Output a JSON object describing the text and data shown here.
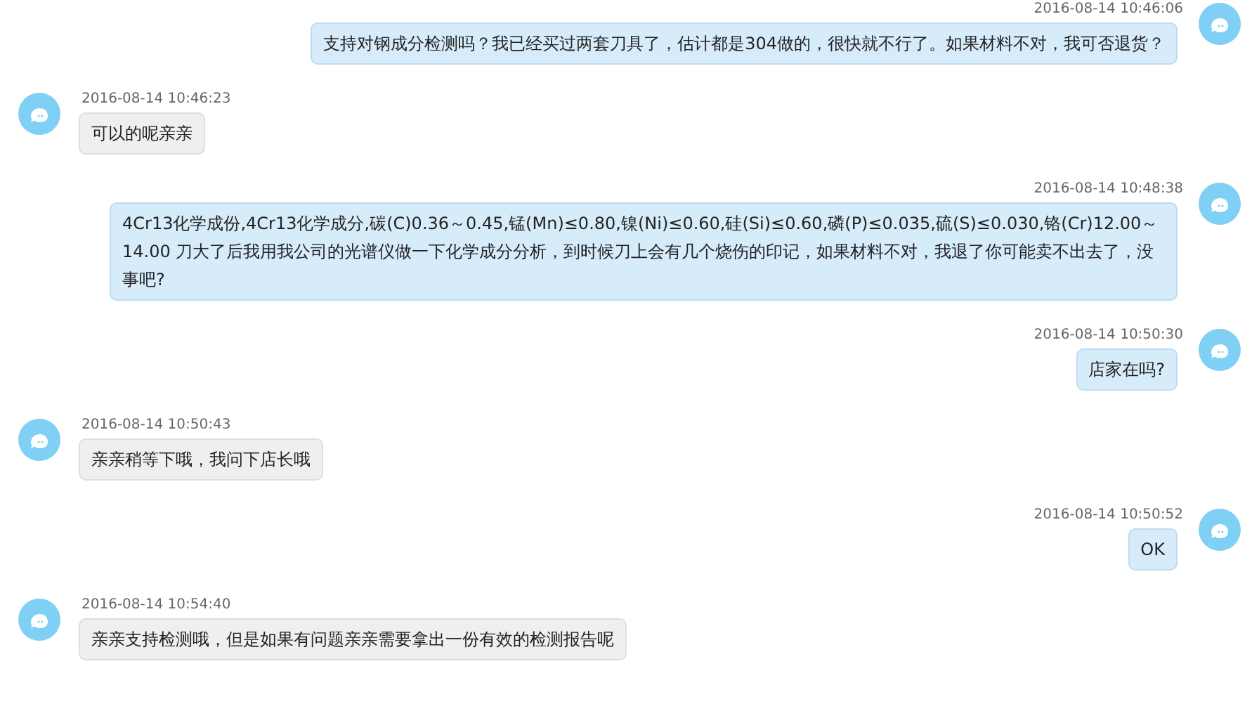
{
  "messages": [
    {
      "kind": "sent",
      "time": "2016-08-14 10:46:06",
      "text": "支持对钢成分检测吗？我已经买过两套刀具了，估计都是304做的，很快就不行了。如果材料不对，我可否退货？"
    },
    {
      "kind": "received",
      "time": "2016-08-14 10:46:23",
      "text": "可以的呢亲亲"
    },
    {
      "kind": "sent",
      "time": "2016-08-14 10:48:38",
      "text": "4Cr13化学成份,4Cr13化学成分,碳(C)0.36～0.45,锰(Mn)≤0.80,镍(Ni)≤0.60,硅(Si)≤0.60,磷(P)≤0.035,硫(S)≤0.030,铬(Cr)12.00～14.00 刀大了后我用我公司的光谱仪做一下化学成分分析，到时候刀上会有几个烧伤的印记，如果材料不对，我退了你可能卖不出去了，没事吧?"
    },
    {
      "kind": "sent",
      "time": "2016-08-14 10:50:30",
      "text": "店家在吗?"
    },
    {
      "kind": "received",
      "time": "2016-08-14 10:50:43",
      "text": "亲亲稍等下哦，我问下店长哦"
    },
    {
      "kind": "sent",
      "time": "2016-08-14 10:50:52",
      "text": "OK"
    },
    {
      "kind": "received",
      "time": "2016-08-14 10:54:40",
      "text": "亲亲支持检测哦，但是如果有问题亲亲需要拿出一份有效的检测报告呢"
    }
  ]
}
